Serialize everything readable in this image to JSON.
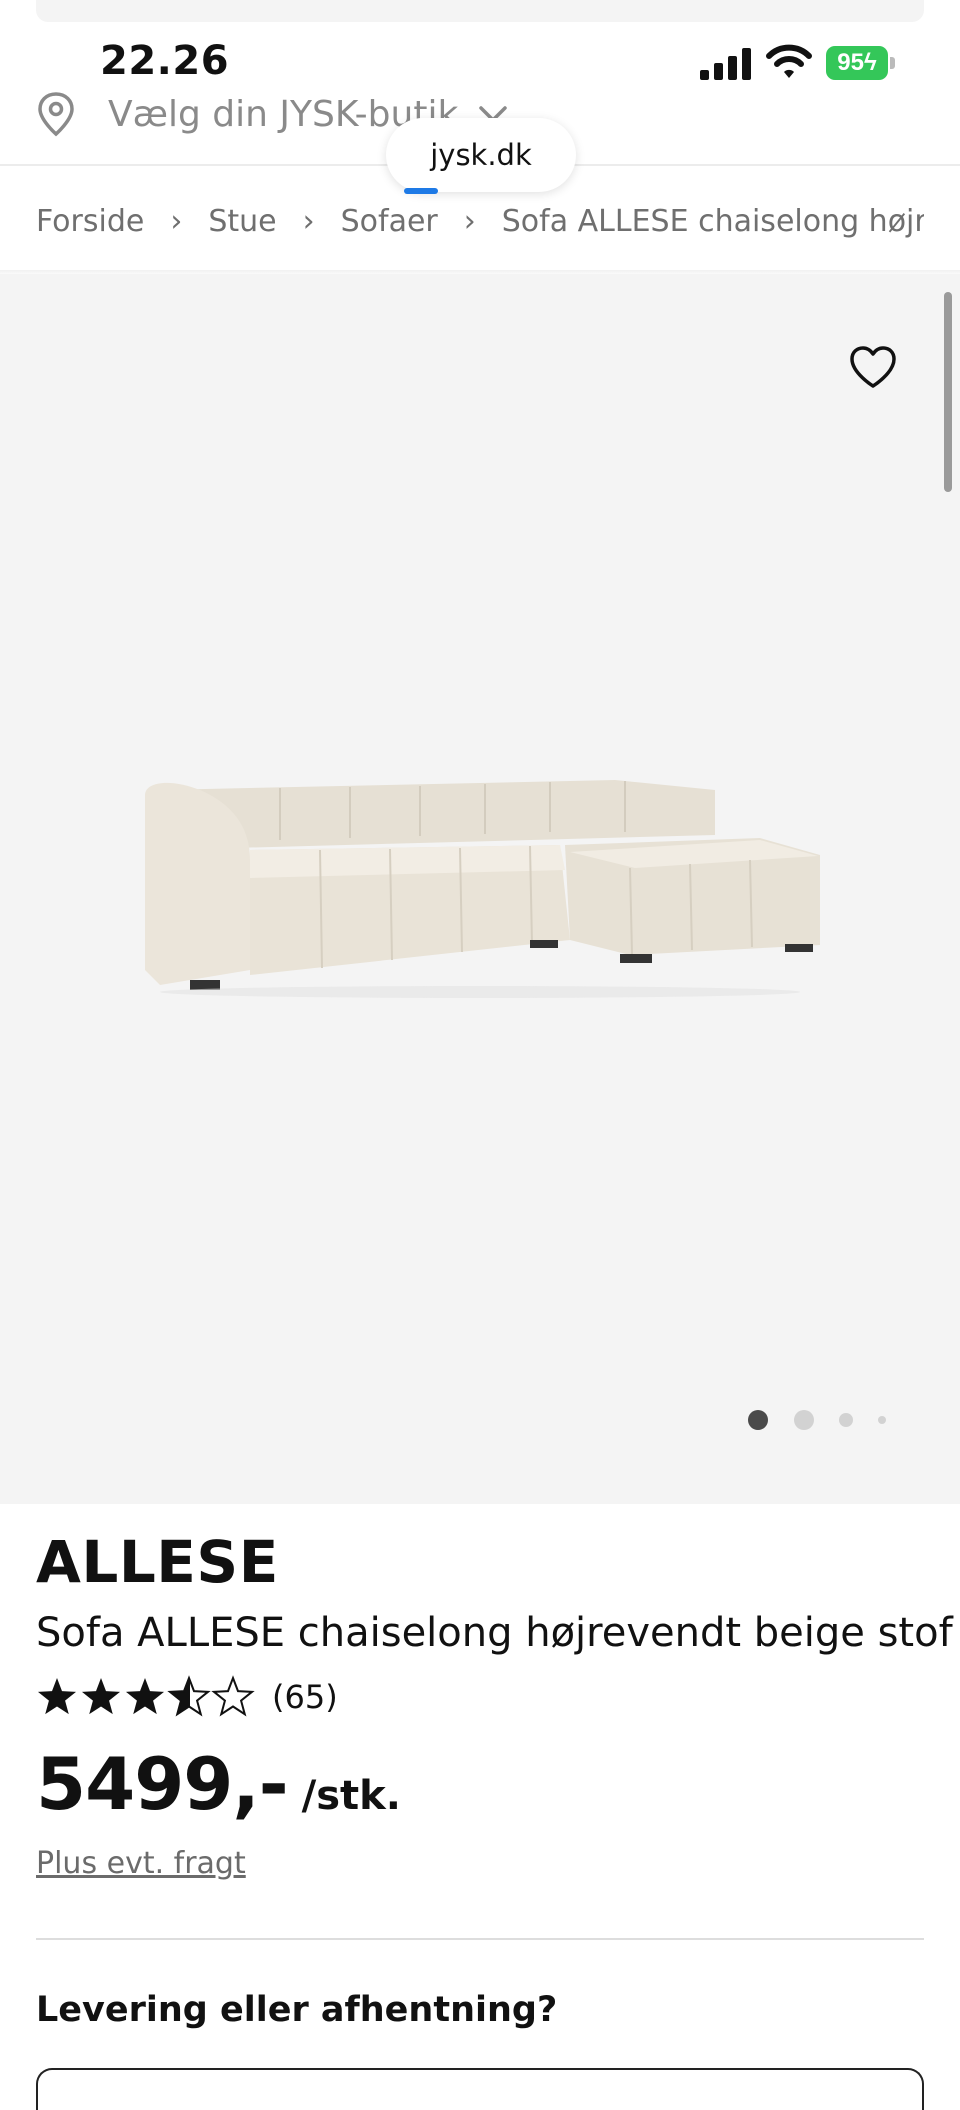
{
  "status_bar": {
    "time": "22.26",
    "battery": "95",
    "battery_color": "#34c759"
  },
  "header": {
    "store_selector": "Vælg din JYSK-butik",
    "url": "jysk.dk",
    "pin_icon": "location-pin-icon",
    "chevron_icon": "chevron-down-icon"
  },
  "breadcrumb": {
    "items": [
      "Forside",
      "Stue",
      "Sofaer"
    ],
    "current": "Sofa ALLESE chaiselong højrevendt beige stof"
  },
  "gallery": {
    "wishlist_icon": "heart-outline-icon",
    "image": "sofa-image",
    "dot_count": 4,
    "active_dot": 0
  },
  "product": {
    "brand": "ALLESE",
    "name": "Sofa ALLESE chaiselong højrevendt beige stof",
    "rating": 3.5,
    "rating_max": 5,
    "review_count": "(65)",
    "price": "5499,-",
    "unit": "/stk.",
    "freight_link": "Plus evt. fragt"
  },
  "delivery": {
    "heading": "Levering eller afhentning?"
  },
  "colors": {
    "accent_blue": "#1e7ae6",
    "gallery_bg": "#f4f4f4",
    "muted_text": "#6f6f6f"
  }
}
